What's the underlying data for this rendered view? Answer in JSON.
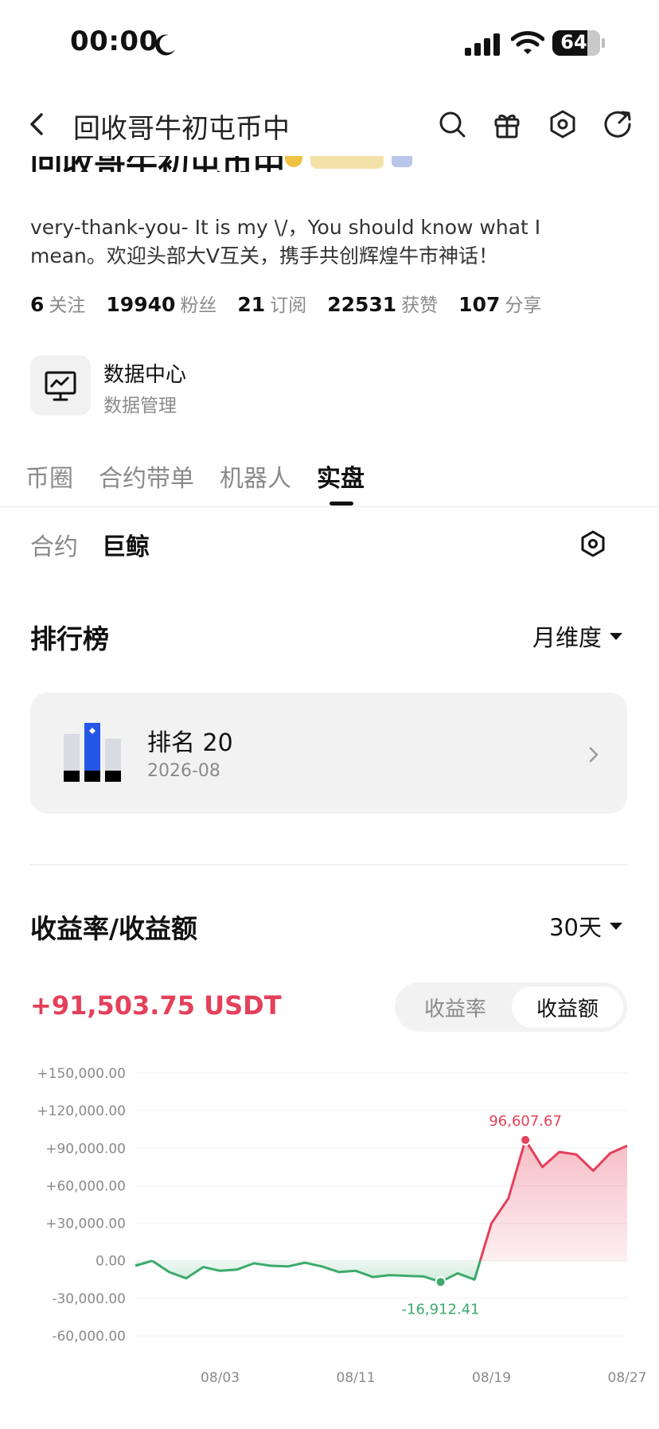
{
  "status_bar": {
    "time": "00:00",
    "battery": "64"
  },
  "header": {
    "title": "回收哥牛初屯币中"
  },
  "profile": {
    "name": "回收哥牛初屯币中",
    "bio_line1": "very-thank-you-    It is my \\/，You should know what I",
    "bio_line2": "mean。欢迎头部大V互关，携手共创辉煌牛市神话！",
    "stats": [
      {
        "value": "6",
        "label": "关注"
      },
      {
        "value": "19940",
        "label": "粉丝"
      },
      {
        "value": "21",
        "label": "订阅"
      },
      {
        "value": "22531",
        "label": "获赞"
      },
      {
        "value": "107",
        "label": "分享"
      }
    ]
  },
  "data_center": {
    "title": "数据中心",
    "subtitle": "数据管理"
  },
  "tabs": [
    "币圈",
    "合约带单",
    "机器人",
    "实盘"
  ],
  "subtabs": [
    "合约",
    "巨鲸"
  ],
  "ranking": {
    "title": "排行榜",
    "period": "月维度",
    "card_title": "排名 20",
    "card_date": "2026-08"
  },
  "profit": {
    "title": "收益率/收益额",
    "period": "30天",
    "value": "+91,503.75 USDT",
    "toggle_rate": "收益率",
    "toggle_amount": "收益额"
  },
  "colors": {
    "positive": "#e4405a",
    "negative": "#3daa6c",
    "accent_blue": "#2456e8"
  },
  "chart_data": {
    "type": "area",
    "y_ticks": [
      "+150,000.00",
      "+120,000.00",
      "+90,000.00",
      "+60,000.00",
      "+30,000.00",
      "0.00",
      "-30,000.00",
      "-60,000.00"
    ],
    "ylim": [
      -60000,
      150000
    ],
    "x_tick_labels": [
      "08/03",
      "08/11",
      "08/19",
      "08/27"
    ],
    "x_tick_index": [
      5,
      13,
      21,
      29
    ],
    "values": [
      -4000,
      0,
      -9000,
      -14000,
      -5000,
      -8000,
      -7000,
      -2000,
      -4000,
      -4500,
      -1500,
      -4500,
      -9000,
      -8000,
      -13000,
      -11500,
      -12000,
      -12500,
      -16912.41,
      -10000,
      -15000,
      30000,
      50000,
      96607.67,
      75000,
      87000,
      85000,
      72000,
      86000,
      92000
    ],
    "max_label": "96,607.67",
    "max_index": 23,
    "min_label": "-16,912.41",
    "min_index": 18,
    "grid": true
  }
}
